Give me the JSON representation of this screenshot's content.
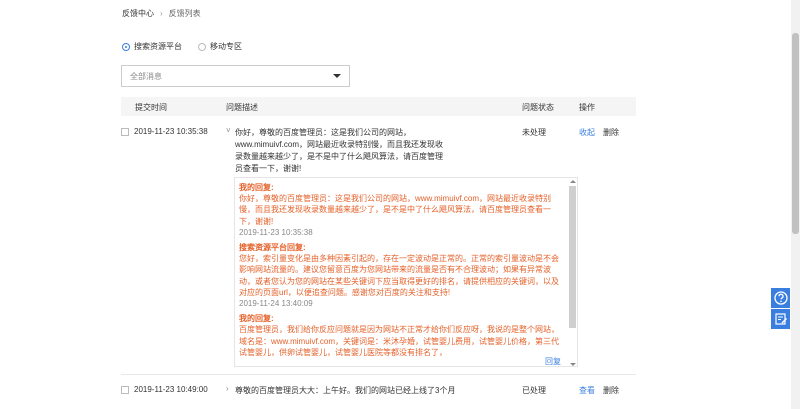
{
  "breadcrumb": {
    "home": "反馈中心",
    "separator": "›",
    "current": "反馈列表"
  },
  "platform": {
    "options": [
      "搜索资源平台",
      "移动专区"
    ],
    "selected": 0
  },
  "filter": {
    "value": "全部消息"
  },
  "table": {
    "headers": [
      "提交时间",
      "问题描述",
      "问题状态",
      "操作"
    ],
    "rows": [
      {
        "time": "2019-11-23 10:35:38",
        "desc": "你好，尊敬的百度管理员：这是我们公司的网站，www.mimuivf.com，网站最近收录特别慢，而且我还发现收录数量越来越少了，是不是中了什么飓风算法，请百度管理员查看一下，谢谢!",
        "status": "未处理",
        "actions": [
          "收起",
          "删除"
        ],
        "thread": [
          {
            "author": "我的回复:",
            "text": "你好，尊敬的百度管理员：这是我们公司的网站，www.mimuivf.com，网站最近收录特别慢，而且我还发现收录数量越来越少了，是不是中了什么飓风算法，请百度管理员查看一下，谢谢!",
            "time": "2019-11-23 10:35:38"
          },
          {
            "author": "搜索资源平台回复:",
            "text": "您好，索引量变化是由多种因素引起的，存在一定波动是正常的。正常的索引量波动是不会影响网站流量的。建议您留意百度为您网站带来的流量是否有不合理波动；如果有异常波动，或者您认为您的网站在某些关键词下应当取得更好的排名，请提供相应的关键词，以及对应的页面url，以便追查问题。感谢您对百度的关注和支持!",
            "time": "2019-11-24 13:40:09"
          },
          {
            "author": "我的回复:",
            "text": "百度管理员，我们给你反应问题就是因为网站不正常才给你们反应呀，我说的是整个网站，域名是：www.mimuivf.com，关键词是：米沐孕婚，试管婴儿费用，试管婴儿价格，第三代试管婴儿，供卵试管婴儿，试管婴儿医院等都没有排名了，",
            "time": ""
          }
        ],
        "reply_label": "回复"
      },
      {
        "time": "2019-11-23 10:49:00",
        "desc": "尊敬的百度管理员大大：上午好。我们的网站已经上线了3个月",
        "status": "已处理",
        "actions": [
          "查看",
          "删除"
        ]
      }
    ]
  },
  "side_buttons": [
    "help-icon",
    "feedback-edit-icon"
  ],
  "colors": {
    "accent": "#3a7fe0",
    "reply_text": "#e4612a",
    "header_bg": "#f5f5f5"
  }
}
